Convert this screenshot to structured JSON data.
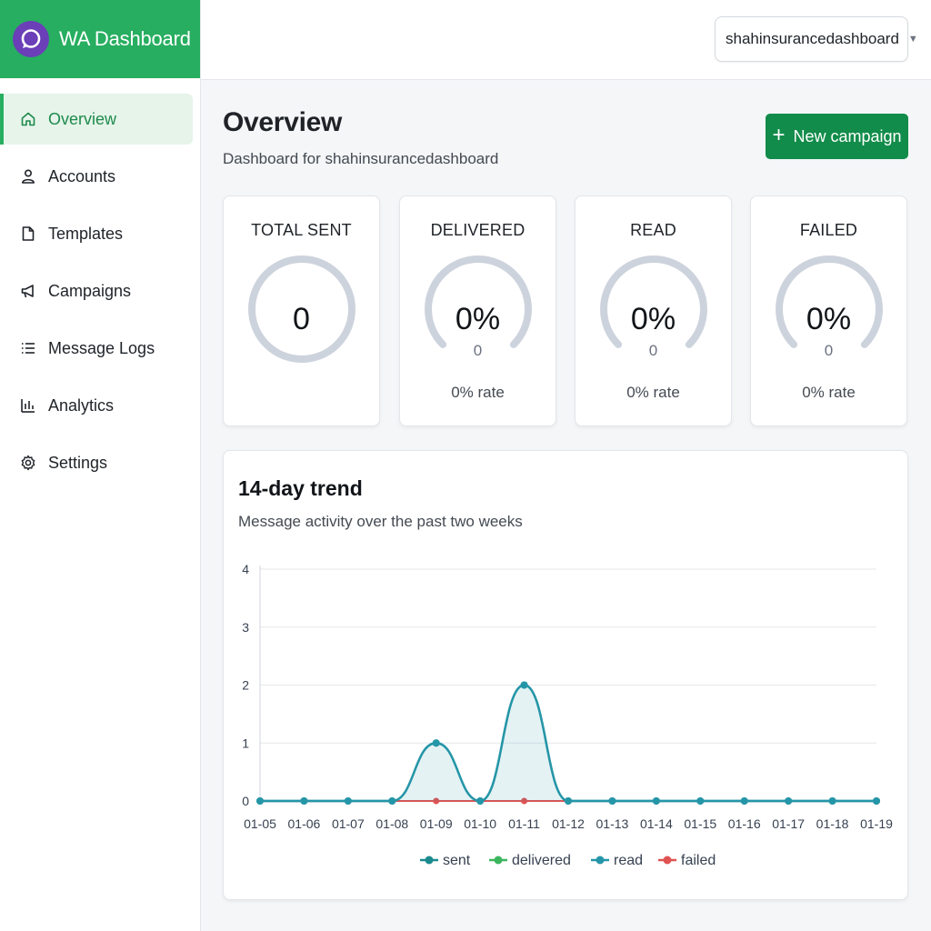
{
  "brand": {
    "title": "WA Dashboard"
  },
  "sidebar": {
    "items": [
      {
        "label": "Overview",
        "icon": "home-icon",
        "active": true
      },
      {
        "label": "Accounts",
        "icon": "user-icon",
        "active": false
      },
      {
        "label": "Templates",
        "icon": "document-icon",
        "active": false
      },
      {
        "label": "Campaigns",
        "icon": "megaphone-icon",
        "active": false
      },
      {
        "label": "Message Logs",
        "icon": "list-icon",
        "active": false
      },
      {
        "label": "Analytics",
        "icon": "bar-chart-icon",
        "active": false
      },
      {
        "label": "Settings",
        "icon": "gear-icon",
        "active": false
      }
    ]
  },
  "topbar": {
    "account": "shahinsurancedashboard"
  },
  "header": {
    "title": "Overview",
    "subtitle": "Dashboard for shahinsurancedashboard",
    "new_campaign_label": "New campaign"
  },
  "stats": [
    {
      "label": "TOTAL SENT",
      "value": "0",
      "count": "",
      "rate": "",
      "percent": 0
    },
    {
      "label": "DELIVERED",
      "value": "0%",
      "count": "0",
      "rate": "0% rate",
      "percent": 0
    },
    {
      "label": "READ",
      "value": "0%",
      "count": "0",
      "rate": "0% rate",
      "percent": 0
    },
    {
      "label": "FAILED",
      "value": "0%",
      "count": "0",
      "rate": "0% rate",
      "percent": 0
    }
  ],
  "trend": {
    "title": "14-day trend",
    "subtitle": "Message activity over the past two weeks"
  },
  "colors": {
    "brand": "#27ae60",
    "primary_button": "#128c4a",
    "gauge_track": "#cdd3dd",
    "sent": "#1b8a8f",
    "delivered": "#3cb55e",
    "read": "#2596a8",
    "failed": "#e05353"
  },
  "chart_data": {
    "type": "line",
    "x": [
      "01-05",
      "01-06",
      "01-07",
      "01-08",
      "01-09",
      "01-10",
      "01-11",
      "01-12",
      "01-13",
      "01-14",
      "01-15",
      "01-16",
      "01-17",
      "01-18",
      "01-19"
    ],
    "series": [
      {
        "name": "sent",
        "values": [
          0,
          0,
          0,
          0,
          1,
          0,
          2,
          0,
          0,
          0,
          0,
          0,
          0,
          0,
          0
        ]
      },
      {
        "name": "delivered",
        "values": [
          0,
          0,
          0,
          0,
          0,
          0,
          0,
          0,
          0,
          0,
          0,
          0,
          0,
          0,
          0
        ]
      },
      {
        "name": "read",
        "values": [
          0,
          0,
          0,
          0,
          1,
          0,
          2,
          0,
          0,
          0,
          0,
          0,
          0,
          0,
          0
        ]
      },
      {
        "name": "failed",
        "values": [
          0,
          0,
          0,
          0,
          0,
          0,
          0,
          0,
          0,
          0,
          0,
          0,
          0,
          0,
          0
        ]
      }
    ],
    "ylim": [
      0,
      4
    ],
    "yticks": [
      0,
      1,
      2,
      3,
      4
    ],
    "grid": true,
    "legend": "bottom"
  }
}
